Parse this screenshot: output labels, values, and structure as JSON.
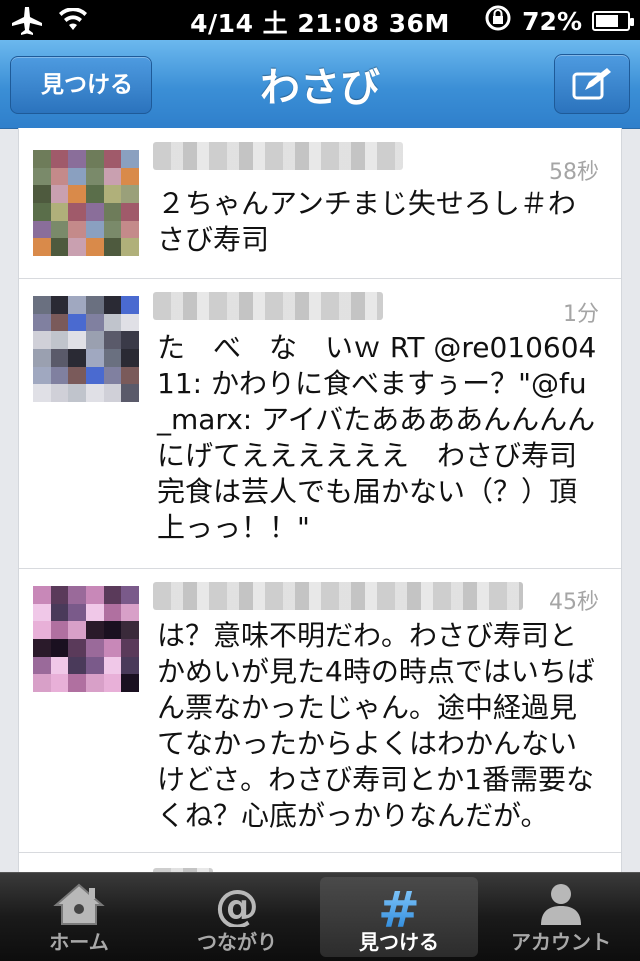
{
  "statusbar": {
    "datetime": "4/14 土 21:08 36M",
    "battery": "72%",
    "battery_level": 0.72
  },
  "nav": {
    "back_label": "見つける",
    "title": "わさび"
  },
  "tweets": [
    {
      "time": "58秒",
      "text": "２ちゃんアンチまじ失せろし＃わさび寿司"
    },
    {
      "time": "1分",
      "text": "た　べ　な　いｗ RT @re01060411: かわりに食べますぅー？\"@fu_marx: アイバたああああんんんん　にげてええええええ　わさび寿司完食は芸人でも届かない（？）頂上っっ！！\""
    },
    {
      "time": "45秒",
      "text": "は？意味不明だわ。わさび寿司とかめいが見た4時の時点ではいちばん票なかったじゃん。途中経過見てなかったからよくはわかんないけどさ。わさび寿司とか1番需要なくね？心底がっかりなんだが。"
    }
  ],
  "tabs": [
    {
      "label": "ホーム",
      "icon": "home-icon"
    },
    {
      "label": "つながり",
      "icon": "at-icon"
    },
    {
      "label": "見つける",
      "icon": "hash-icon"
    },
    {
      "label": "アカウント",
      "icon": "person-icon"
    }
  ]
}
